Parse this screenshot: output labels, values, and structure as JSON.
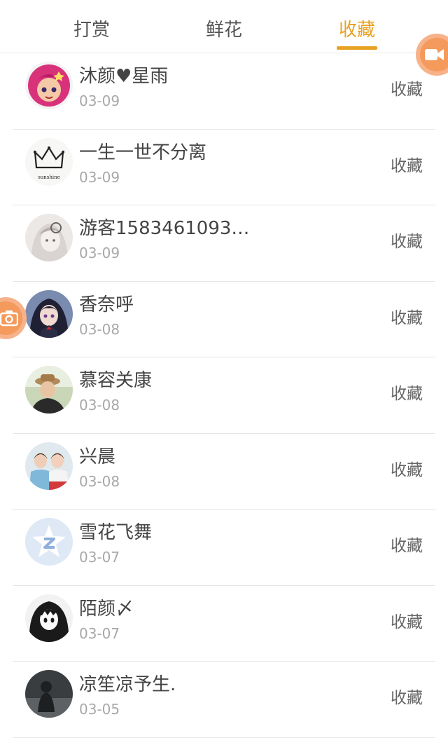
{
  "tabs": [
    {
      "label": "打赏"
    },
    {
      "label": "鲜花"
    },
    {
      "label": "收藏",
      "active": true
    }
  ],
  "accent_color": "#e8a222",
  "action_label": "收藏",
  "rows": [
    {
      "name": "沐颜♥星雨",
      "date": "03-09",
      "avatar": "cartoon-girl-avatar"
    },
    {
      "name": "一生一世不分离",
      "date": "03-09",
      "avatar": "crown-sunshine-avatar",
      "avatar_text": "sunshine"
    },
    {
      "name": "游客1583461093…",
      "date": "03-09",
      "avatar": "sketch-girl-avatar"
    },
    {
      "name": "香奈呼",
      "date": "03-08",
      "avatar": "anime-girl-avatar"
    },
    {
      "name": "慕容关康",
      "date": "03-08",
      "avatar": "boy-hat-avatar"
    },
    {
      "name": "兴晨",
      "date": "03-08",
      "avatar": "two-girls-avatar"
    },
    {
      "name": "雪花飞舞",
      "date": "03-07",
      "avatar": "qq-star-avatar"
    },
    {
      "name": "陌颜〆",
      "date": "03-07",
      "avatar": "manga-girl-avatar"
    },
    {
      "name": "凉笙凉予生.",
      "date": "03-05",
      "avatar": "dark-photo-avatar"
    }
  ],
  "floating": {
    "video_icon": "video-camera-icon",
    "camera_icon": "camera-icon"
  }
}
